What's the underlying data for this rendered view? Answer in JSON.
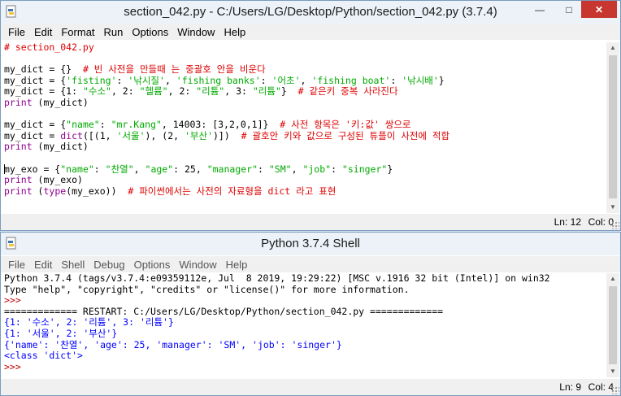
{
  "editor": {
    "title": "section_042.py - C:/Users/LG/Desktop/Python/section_042.py (3.7.4)",
    "menu": [
      "File",
      "Edit",
      "Format",
      "Run",
      "Options",
      "Window",
      "Help"
    ],
    "lines": [
      [
        {
          "t": "# section_042.py",
          "c": "com"
        }
      ],
      [],
      [
        {
          "t": "my_dict = {}  ",
          "c": ""
        },
        {
          "t": "# 빈 사전을 만들때 는 중괄호 안을 비운다",
          "c": "com"
        }
      ],
      [
        {
          "t": "my_dict = {",
          "c": ""
        },
        {
          "t": "'fisting'",
          "c": "str"
        },
        {
          "t": ": ",
          "c": ""
        },
        {
          "t": "'낚시질'",
          "c": "str"
        },
        {
          "t": ", ",
          "c": ""
        },
        {
          "t": "'fishing banks'",
          "c": "str"
        },
        {
          "t": ": ",
          "c": ""
        },
        {
          "t": "'어초'",
          "c": "str"
        },
        {
          "t": ", ",
          "c": ""
        },
        {
          "t": "'fishing boat'",
          "c": "str"
        },
        {
          "t": ": ",
          "c": ""
        },
        {
          "t": "'낚시배'",
          "c": "str"
        },
        {
          "t": "}",
          "c": ""
        }
      ],
      [
        {
          "t": "my_dict = {1: ",
          "c": ""
        },
        {
          "t": "\"수소\"",
          "c": "str"
        },
        {
          "t": ", 2: ",
          "c": ""
        },
        {
          "t": "\"헬륨\"",
          "c": "str"
        },
        {
          "t": ", 2: ",
          "c": ""
        },
        {
          "t": "\"리튬\"",
          "c": "str"
        },
        {
          "t": ", 3: ",
          "c": ""
        },
        {
          "t": "\"리튬\"",
          "c": "str"
        },
        {
          "t": "}  ",
          "c": ""
        },
        {
          "t": "# 같은키 중복 사라진다",
          "c": "com"
        }
      ],
      [
        {
          "t": "print",
          "c": "bi"
        },
        {
          "t": " (my_dict)",
          "c": ""
        }
      ],
      [],
      [
        {
          "t": "my_dict = {",
          "c": ""
        },
        {
          "t": "\"name\"",
          "c": "str"
        },
        {
          "t": ": ",
          "c": ""
        },
        {
          "t": "\"mr.Kang\"",
          "c": "str"
        },
        {
          "t": ", 14003: [3,2,0,1]}  ",
          "c": ""
        },
        {
          "t": "# 사전 항목은 '키:값' 쌍으로",
          "c": "com"
        }
      ],
      [
        {
          "t": "my_dict = ",
          "c": ""
        },
        {
          "t": "dict",
          "c": "bi"
        },
        {
          "t": "([(1, ",
          "c": ""
        },
        {
          "t": "'서울'",
          "c": "str"
        },
        {
          "t": "), (2, ",
          "c": ""
        },
        {
          "t": "'부산'",
          "c": "str"
        },
        {
          "t": ")])  ",
          "c": ""
        },
        {
          "t": "# 괄호안 키와 값으로 구성된 튜플이 사전에 적합",
          "c": "com"
        }
      ],
      [
        {
          "t": "print",
          "c": "bi"
        },
        {
          "t": " (my_dict)",
          "c": ""
        }
      ],
      [],
      [
        {
          "t": "|",
          "c": "cursor"
        },
        {
          "t": "my_exo = {",
          "c": ""
        },
        {
          "t": "\"name\"",
          "c": "str"
        },
        {
          "t": ": ",
          "c": ""
        },
        {
          "t": "\"찬열\"",
          "c": "str"
        },
        {
          "t": ", ",
          "c": ""
        },
        {
          "t": "\"age\"",
          "c": "str"
        },
        {
          "t": ": 25, ",
          "c": ""
        },
        {
          "t": "\"manager\"",
          "c": "str"
        },
        {
          "t": ": ",
          "c": ""
        },
        {
          "t": "\"SM\"",
          "c": "str"
        },
        {
          "t": ", ",
          "c": ""
        },
        {
          "t": "\"job\"",
          "c": "str"
        },
        {
          "t": ": ",
          "c": ""
        },
        {
          "t": "\"singer\"",
          "c": "str"
        },
        {
          "t": "}",
          "c": ""
        }
      ],
      [
        {
          "t": "print",
          "c": "bi"
        },
        {
          "t": " (my_exo)",
          "c": ""
        }
      ],
      [
        {
          "t": "print",
          "c": "bi"
        },
        {
          "t": " (",
          "c": ""
        },
        {
          "t": "type",
          "c": "bi"
        },
        {
          "t": "(my_exo))  ",
          "c": ""
        },
        {
          "t": "# 파이썬에서는 사전의 자료형을 dict 라고 표현",
          "c": "com"
        }
      ]
    ],
    "status_ln": "Ln: 12",
    "status_col": "Col: 0"
  },
  "shell": {
    "title": "Python 3.7.4 Shell",
    "menu": [
      "File",
      "Edit",
      "Shell",
      "Debug",
      "Options",
      "Window",
      "Help"
    ],
    "lines": [
      [
        {
          "t": "Python 3.7.4 (tags/v3.7.4:e09359112e, Jul  8 2019, 19:29:22) [MSC v.1916 32 bit (Intel)] on win32",
          "c": ""
        }
      ],
      [
        {
          "t": "Type \"help\", \"copyright\", \"credits\" or \"license()\" for more information.",
          "c": ""
        }
      ],
      [
        {
          "t": ">>> ",
          "c": "prompt"
        }
      ],
      [
        {
          "t": "============= RESTART: C:/Users/LG/Desktop/Python/section_042.py =============",
          "c": ""
        }
      ],
      [
        {
          "t": "{1: '수소', 2: '리튬', 3: '리튬'}",
          "c": "out"
        }
      ],
      [
        {
          "t": "{1: '서울', 2: '부산'}",
          "c": "out"
        }
      ],
      [
        {
          "t": "{'name': '찬열', 'age': 25, 'manager': 'SM', 'job': 'singer'}",
          "c": "out"
        }
      ],
      [
        {
          "t": "<class 'dict'>",
          "c": "out"
        }
      ],
      [
        {
          "t": ">>> ",
          "c": "prompt"
        }
      ]
    ],
    "status_ln": "Ln: 9",
    "status_col": "Col: 4"
  },
  "icons": {
    "window_icon": "python-file-icon",
    "minimize": "minimize-icon",
    "maximize": "maximize-icon",
    "close": "close-icon"
  }
}
